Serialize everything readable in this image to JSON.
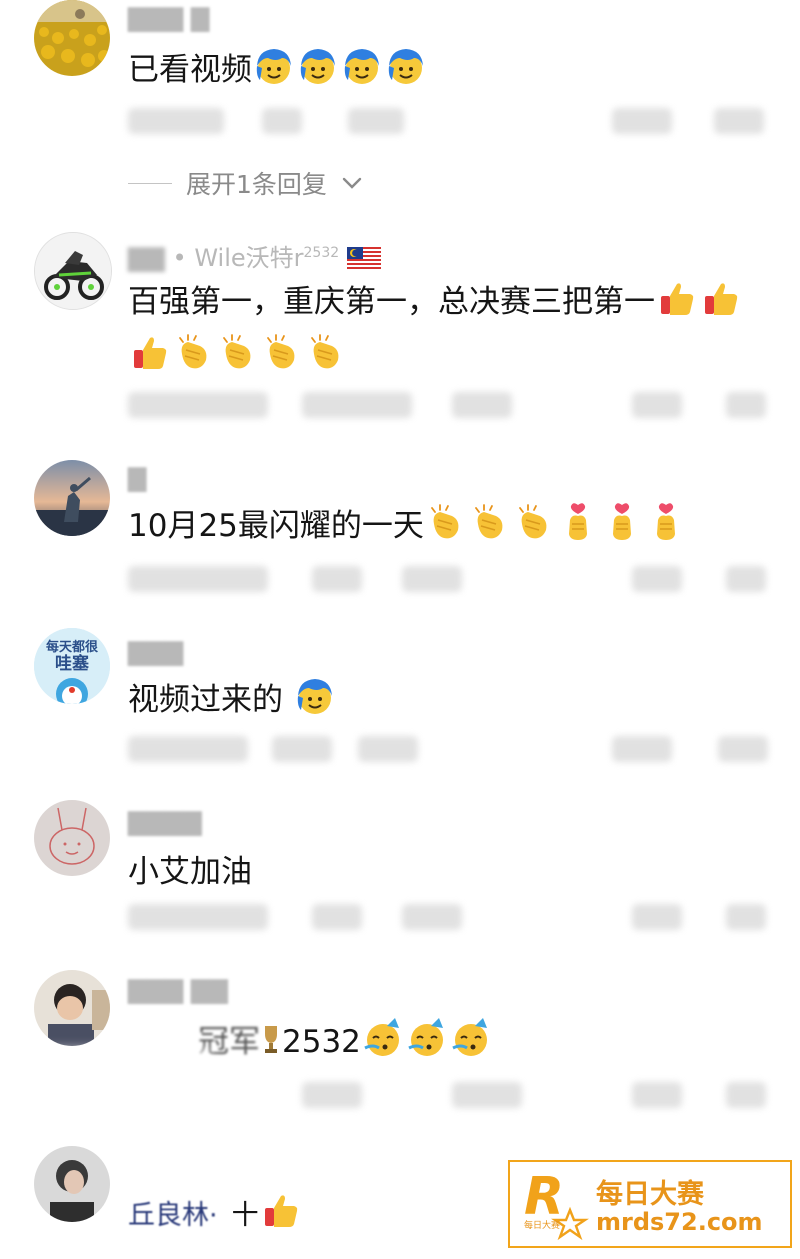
{
  "comments": [
    {
      "username": "",
      "text": "已看视频",
      "emojis": [
        "blue-hair-face-icon",
        "blue-hair-face-icon",
        "blue-hair-face-icon",
        "blue-hair-face-icon"
      ]
    },
    {
      "username": "• Wile沃特r",
      "username_superscript": "2532",
      "text_line1": "百强第一，重庆第一，总决赛三把第一",
      "emojis_line1": [
        "thumbs-up-icon",
        "thumbs-up-icon"
      ],
      "emojis_line2": [
        "thumbs-up-icon",
        "clapping-hands-icon",
        "clapping-hands-icon",
        "clapping-hands-icon",
        "clapping-hands-icon"
      ]
    },
    {
      "username": "",
      "text": "10月25最闪耀的一天",
      "emojis": [
        "clapping-hands-icon",
        "clapping-hands-icon",
        "clapping-hands-icon",
        "finger-heart-icon",
        "finger-heart-icon",
        "finger-heart-icon"
      ]
    },
    {
      "username": "",
      "avatar_text_line1": "每天都很",
      "avatar_text_line2": "哇塞",
      "text": "视频过来的",
      "emojis": [
        "blue-hair-face-icon"
      ]
    },
    {
      "username": "",
      "text": "小艾加油",
      "emojis": []
    },
    {
      "username": "",
      "text_prefix": "冠军",
      "text": "2532",
      "emojis": [
        "party-face-icon",
        "party-face-icon",
        "party-face-icon"
      ]
    },
    {
      "username": "",
      "text_prefix": "丘良林·",
      "text": "十",
      "emojis": [
        "thumbs-up-icon"
      ]
    }
  ],
  "expand_replies": "展开1条回复",
  "watermark": {
    "title": "每日大赛",
    "url": "mrds72.com",
    "logo_letter": "R",
    "logo_small": "每日大赛"
  },
  "colors": {
    "text": "#151515",
    "muted": "#8a8a8a",
    "brand": "#e8941a"
  }
}
